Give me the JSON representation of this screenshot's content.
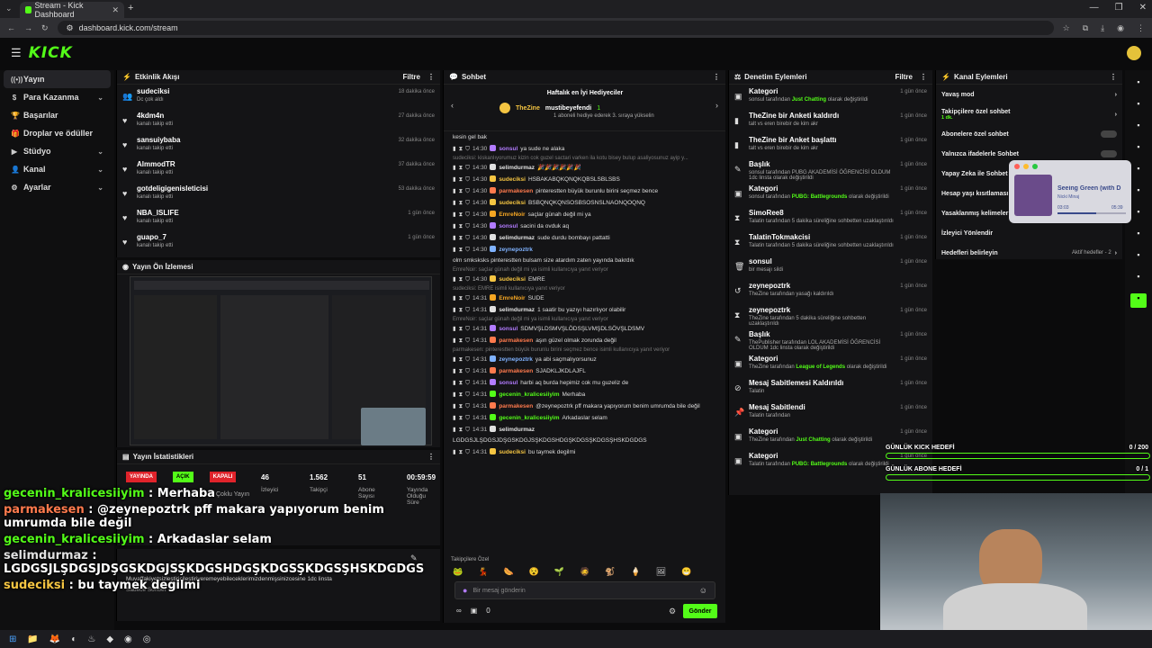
{
  "browser": {
    "tab_title": "Stream - Kick Dashboard",
    "url": "dashboard.kick.com/stream"
  },
  "brand": {
    "logo": "KICK",
    "accent": "#53fc18"
  },
  "sidebar": {
    "items": [
      {
        "label": "Yayın",
        "icon": "broadcast-icon",
        "active": true
      },
      {
        "label": "Para Kazanma",
        "icon": "money-icon",
        "chevron": true
      },
      {
        "label": "Başarılar",
        "icon": "trophy-icon"
      },
      {
        "label": "Droplar ve ödüller",
        "icon": "gift-icon"
      },
      {
        "label": "Stüdyo",
        "icon": "studio-icon",
        "chevron": true
      },
      {
        "label": "Kanal",
        "icon": "user-icon",
        "chevron": true
      },
      {
        "label": "Ayarlar",
        "icon": "gear-icon",
        "chevron": true
      }
    ]
  },
  "activity": {
    "title": "Etkinlik Akışı",
    "filter": "Filtre",
    "items": [
      {
        "user": "sudeciksi",
        "sub": "Dc çok aldı",
        "time": "18 dakika önce",
        "icon": "people-icon"
      },
      {
        "user": "4kdm4n",
        "sub": "kanalı takip etti",
        "time": "27 dakika önce",
        "icon": "heart-icon"
      },
      {
        "user": "sansuiybaba",
        "sub": "kanalı takip etti",
        "time": "32 dakika önce",
        "icon": "heart-icon"
      },
      {
        "user": "AlmmodTR",
        "sub": "kanalı takip etti",
        "time": "37 dakika önce",
        "icon": "heart-icon"
      },
      {
        "user": "gotdeligigenisleticisi",
        "sub": "kanalı takip etti",
        "time": "53 dakika önce",
        "icon": "heart-icon"
      },
      {
        "user": "NBA_ISLIFE",
        "sub": "kanalı takip etti",
        "time": "1 gün önce",
        "icon": "heart-icon"
      },
      {
        "user": "guapo_7",
        "sub": "kanalı takip etti",
        "time": "1 gün önce",
        "icon": "heart-icon"
      }
    ]
  },
  "preview": {
    "title": "Yayın Ön İzlemesi"
  },
  "stats": {
    "title": "Yayın İstatistikleri",
    "badges": [
      "YAYINDA",
      "AÇIK",
      "KAPALI"
    ],
    "labels": [
      "Çoklu Yayın"
    ],
    "values": [
      {
        "val": "46",
        "label": "İzleyici"
      },
      {
        "val": "1.562",
        "label": "Takipçi"
      },
      {
        "val": "51",
        "label": "Abone Sayısı"
      },
      {
        "val": "00:59:59",
        "label": "Yayında Olduğu Süre"
      }
    ]
  },
  "bottom_panel": {
    "text": "Muvaffakiyetsizleştiricileştiriveremeyebileceklerimizdenmişsinizcesine 1dc linsta",
    "sub": "Sadece Sohbet"
  },
  "chat": {
    "title": "Sohbet",
    "gifter_title": "Haftalık en İyi Hediyeciler",
    "gifter_name": "TheZine",
    "gifter2": "mustibeyefendi",
    "gifter_sub": "1 aboneli hediye ederek 3. sıraya yükselin",
    "gifter_count": "1",
    "top_msg": "kesin gel bak",
    "messages": [
      {
        "time": "14:30",
        "user": "sonsul",
        "color": "#b27bff",
        "text": "ya sude ne alaka"
      },
      {
        "reply": "sudeciksi: kiskanlıyorumuz kizin cok guzel sactari varken ila kotu bisey bulup asaliyosunuz ayip y..."
      },
      {
        "time": "14:30",
        "user": "selimdurmaz",
        "color": "#e0e0e0",
        "text": "🎉🎉🎉🎉🎉🎉"
      },
      {
        "time": "14:30",
        "user": "sudeciksi",
        "color": "#f5c542",
        "text": "HSBAKABQKQNQKQBSLSBLSBS"
      },
      {
        "time": "14:30",
        "user": "parmakesen",
        "color": "#ff7a4d",
        "text": "pinterestten büyük burunlu birini seçmez bence"
      },
      {
        "time": "14:30",
        "user": "sudeciksi",
        "color": "#f5c542",
        "text": "BSBQNQKQNSOSBSOSNSLNAONQOQNQ"
      },
      {
        "time": "14:30",
        "user": "EmreNoir",
        "color": "#f5a623",
        "text": "saçlar günah değil mi ya"
      },
      {
        "time": "14:30",
        "user": "sonsul",
        "color": "#b27bff",
        "text": "sacini da ovduk aq"
      },
      {
        "time": "14:30",
        "user": "selimdurmaz",
        "color": "#e0e0e0",
        "text": "sude durdu bombayı pattatti"
      },
      {
        "time": "14:30",
        "user": "zeynepoztrk",
        "color": "#7fb2ff",
        "text": "olm smksksks pinterestten bulsam size atardım zaten yayında bakrdık"
      },
      {
        "reply": "EmreNoir: saçlar günah değil mi ya isimli kullanıcıya yanıt veriyor"
      },
      {
        "time": "14:30",
        "user": "sudeciksi",
        "color": "#f5c542",
        "text": "EMRE"
      },
      {
        "reply": "sudeciksi: EMRE isimli kullanıcıya yanıt veriyor"
      },
      {
        "time": "14:31",
        "user": "EmreNoir",
        "color": "#f5a623",
        "text": "SUDE"
      },
      {
        "time": "14:31",
        "user": "selimdurmaz",
        "color": "#e0e0e0",
        "text": "1 saatir bu yazıyı hazırlıyor olabilir"
      },
      {
        "reply": "EmreNoir: saçlar günah değil mi ya isimli kullanıcıya yanıt veriyor"
      },
      {
        "time": "14:31",
        "user": "sonsul",
        "color": "#b27bff",
        "text": "SDMVŞLDSMVŞLÖDSŞLVMŞDLSÖVŞLDSMV"
      },
      {
        "time": "14:31",
        "user": "parmakesen",
        "color": "#ff7a4d",
        "text": "aşın güzel olmak zorunda değil"
      },
      {
        "reply": "parmakesen: pinterestten büyük burunlu birini seçmez bence isimli kullanıcıya yanıt veriyor"
      },
      {
        "time": "14:31",
        "user": "zeynepoztrk",
        "color": "#7fb2ff",
        "text": "ya abi saçmalıyorsunuz"
      },
      {
        "time": "14:31",
        "user": "parmakesen",
        "color": "#ff7a4d",
        "text": "SJADKLJKDLAJFL"
      },
      {
        "time": "14:31",
        "user": "sonsul",
        "color": "#b27bff",
        "text": "harbi aq burda hepimiz cok mu guzeliz de"
      },
      {
        "time": "14:31",
        "user": "gecenin_kralicesiiyim",
        "color": "#53fc18",
        "text": "Merhaba"
      },
      {
        "time": "14:31",
        "user": "parmakesen",
        "color": "#ff7a4d",
        "text": "@zeynepoztrk pff makara yapıyorum benim umrumda bile değil"
      },
      {
        "time": "14:31",
        "user": "gecenin_kralicesiiyim",
        "color": "#53fc18",
        "text": "Arkadaslar selam"
      },
      {
        "time": "14:31",
        "user": "selimdurmaz",
        "color": "#e0e0e0",
        "text": "LGDGSJLŞDGSJDŞGSKDGJSŞKDGSHDGŞKDGSŞKDGSŞHSKDGDGS"
      },
      {
        "time": "14:31",
        "user": "sudeciksi",
        "color": "#f5c542",
        "text": "bu taymek degilmi"
      }
    ],
    "followers_label": "Takipçilere Özel",
    "input_placeholder": "Bir mesaj gönderin",
    "send": "Gönder",
    "counter": "0"
  },
  "mod": {
    "title": "Denetim Eylemleri",
    "filter": "Filtre",
    "items": [
      {
        "icon": "category-icon",
        "title": "Kategori",
        "sub": "sonsul tarafından ",
        "hl": "Just Chatting",
        "end": " olarak değiştirildi",
        "time": "1 gün önce"
      },
      {
        "icon": "poll-icon",
        "title": "TheZine bir Anketi kaldırdı",
        "sub": "talt vs eren birebir de kim akr",
        "time": "1 gün önce"
      },
      {
        "icon": "poll-icon",
        "title": "TheZine bir Anket başlattı",
        "sub": "talt vs eren birebir de kim akr",
        "time": "1 gün önce"
      },
      {
        "icon": "title-icon",
        "title": "Başlık",
        "sub": "sonsul tarafından PUBG AKADEMİSİ ÖĞRENCİSİ OLDUM 1dc linsta olarak değiştirildi",
        "time": "1 gün önce"
      },
      {
        "icon": "category-icon",
        "title": "Kategori",
        "sub": "sonsul tarafından ",
        "hl": "PUBG: Battlegrounds",
        "end": " olarak değiştirildi",
        "time": "1 gün önce"
      },
      {
        "icon": "hourglass-icon",
        "title": "SimoRee8",
        "sub": "Talatin tarafından 5 dakika süreliğine sohbetten uzaklaştırıldı",
        "time": "1 gün önce"
      },
      {
        "icon": "hourglass-icon",
        "title": "TalatinTokmakcisi",
        "sub": "Talatin tarafından 5 dakika süreliğine sohbetten uzaklaştırıldı",
        "time": "1 gün önce"
      },
      {
        "icon": "trash-icon",
        "title": "sonsul",
        "sub": "bir mesajı sildi",
        "time": "1 gün önce"
      },
      {
        "icon": "undo-icon",
        "title": "zeynepoztrk",
        "sub": "TheZine tarafından yasağı kaldırıldı",
        "time": "1 gün önce"
      },
      {
        "icon": "hourglass-icon",
        "title": "zeynepoztrk",
        "sub": "TheZine tarafından 5 dakika süreliğine sohbetten uzaklaştırıldı",
        "time": "1 gün önce"
      },
      {
        "icon": "title-icon",
        "title": "Başlık",
        "sub": "ThePublisher tarafından LOL AKADEMİSİ ÖĞRENCİSİ OLDUM 1dc linsta olarak değiştirildi",
        "time": "1 gün önce"
      },
      {
        "icon": "category-icon",
        "title": "Kategori",
        "sub": "TheZine tarafından ",
        "hl": "League of Legends",
        "end": " olarak değiştirildi",
        "time": "1 gün önce"
      },
      {
        "icon": "unpin-icon",
        "title": "Mesaj Sabitlemesi Kaldırıldı",
        "sub": "Talatin",
        "time": "1 gün önce"
      },
      {
        "icon": "pin-icon",
        "title": "Mesaj Sabitlendi",
        "sub": "Talatin tarafından",
        "time": "1 gün önce"
      },
      {
        "icon": "category-icon",
        "title": "Kategori",
        "sub": "TheZine tarafından ",
        "hl": "Just Chatting",
        "end": " olarak değiştirildi",
        "time": "1 gün önce"
      },
      {
        "icon": "category-icon",
        "title": "Kategori",
        "sub": "Talatin tarafından ",
        "hl": "PUBG: Battlegrounds",
        "end": " olarak değiştirildi",
        "time": "1 gün önce"
      }
    ]
  },
  "channel": {
    "title": "Kanal Eylemleri",
    "items": [
      {
        "label": "Yavaş mod",
        "kind": "chevron"
      },
      {
        "label": "Takipçilere özel sohbet",
        "sub": "1 dk.",
        "kind": "chevron"
      },
      {
        "label": "Abonelere özel sohbet",
        "kind": "toggle"
      },
      {
        "label": "Yalnızca ifadelerle Sohbet",
        "kind": "toggle"
      },
      {
        "label": "Yapay Zeka ile Sohbet",
        "kind": "none"
      },
      {
        "label": "Hesap yaşı kısıtlaması",
        "kind": "none"
      },
      {
        "label": "Yasaklanmış kelimeler",
        "kind": "none"
      },
      {
        "label": "İzleyici Yönlendir",
        "kind": "none"
      },
      {
        "label": "Hedefleri belirleyin",
        "kind": "chevron",
        "badge": "Aktif hedefler - 2"
      }
    ]
  },
  "spotify": {
    "track": "Seeing Green (with D",
    "artist": "Nicki Minaj",
    "elapsed": "03:03",
    "total": "05:39",
    "progress": 0.56
  },
  "goals": [
    {
      "label": "GÜNLÜK KICK HEDEFİ",
      "value": "0 / 200"
    },
    {
      "label": "GÜNLÜK ABONE HEDEFİ",
      "value": "0 / 1"
    }
  ],
  "overlay_chat": [
    {
      "user": "gecenin_kralicesiiyim",
      "sep": " : ",
      "text": "Merhaba",
      "color": "#53fc18"
    },
    {
      "user": "parmakesen",
      "sep": " : ",
      "text": "@zeynepoztrk pff makara yapıyorum benim umrumda bile değil",
      "color": "#ff7a4d"
    },
    {
      "user": "gecenin_kralicesiiyim",
      "sep": " : ",
      "text": "Arkadaslar selam",
      "color": "#53fc18"
    },
    {
      "user": "selimdurmaz",
      "sep": " : ",
      "text": "LGDGSJLŞDGSJDŞGSKDGJSŞKDGSHDGŞKDGSŞKDGSŞHSKDGDGS",
      "color": "#e0e0e0"
    },
    {
      "user": "sudeciksi",
      "sep": " : ",
      "text": "bu taymek degilmi",
      "color": "#f5c542"
    }
  ]
}
